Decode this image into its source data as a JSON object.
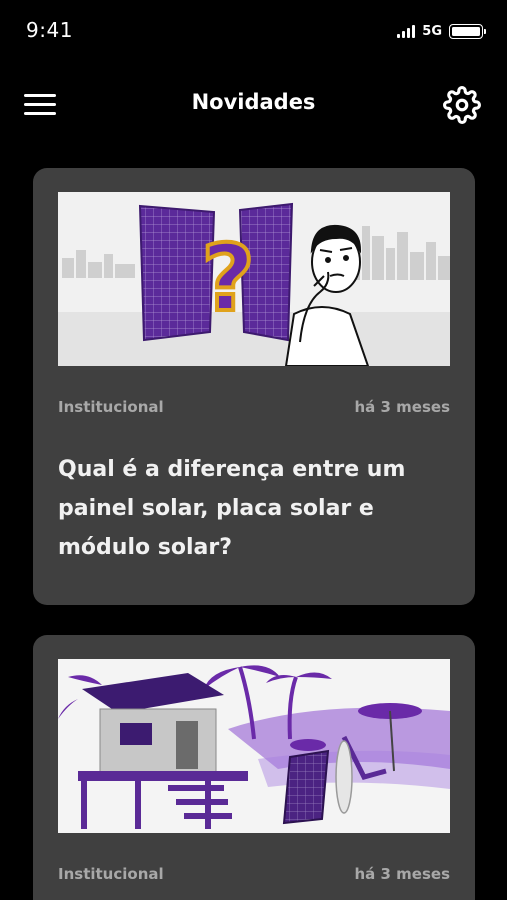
{
  "status_bar": {
    "time": "9:41",
    "network": "5G",
    "signal_icon": "cellular-signal-icon",
    "battery_icon": "battery-icon"
  },
  "header": {
    "title": "Novidades",
    "menu_icon": "hamburger-menu-icon",
    "settings_icon": "gear-icon"
  },
  "colors": {
    "background": "#000000",
    "card": "#404040",
    "meta_text": "#a8a8a8",
    "title_text": "#f1f1f1",
    "accent_purple": "#6a2aa8"
  },
  "news": [
    {
      "category": "Institucional",
      "time_ago": "há 3 meses",
      "title": "Qual é a diferença entre um painel solar, placa solar e módulo solar?",
      "image": "solar-panels-question-illustration"
    },
    {
      "category": "Institucional",
      "time_ago": "há 3 meses",
      "title": "",
      "image": "beach-house-solar-illustration"
    }
  ]
}
